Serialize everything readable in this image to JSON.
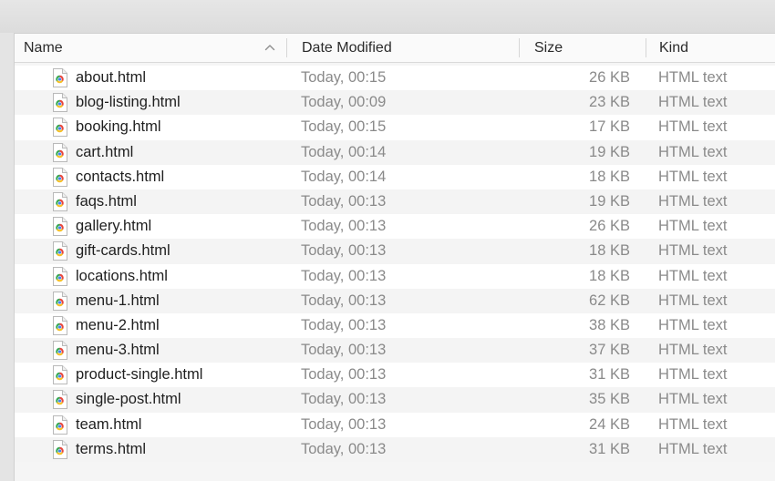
{
  "header": {
    "name": "Name",
    "date_modified": "Date Modified",
    "size": "Size",
    "kind": "Kind"
  },
  "sort": {
    "column": "Name",
    "direction": "ascending",
    "icon": "chevron-up-icon"
  },
  "colors": {
    "icon_red": "#e8453c",
    "icon_yellow": "#f6c026",
    "icon_green": "#34a853",
    "icon_blue": "#4285f4"
  },
  "files": [
    {
      "name": "about.html",
      "date": "Today, 00:15",
      "size": "26 KB",
      "kind": "HTML text"
    },
    {
      "name": "blog-listing.html",
      "date": "Today, 00:09",
      "size": "23 KB",
      "kind": "HTML text"
    },
    {
      "name": "booking.html",
      "date": "Today, 00:15",
      "size": "17 KB",
      "kind": "HTML text"
    },
    {
      "name": "cart.html",
      "date": "Today, 00:14",
      "size": "19 KB",
      "kind": "HTML text"
    },
    {
      "name": "contacts.html",
      "date": "Today, 00:14",
      "size": "18 KB",
      "kind": "HTML text"
    },
    {
      "name": "faqs.html",
      "date": "Today, 00:13",
      "size": "19 KB",
      "kind": "HTML text"
    },
    {
      "name": "gallery.html",
      "date": "Today, 00:13",
      "size": "26 KB",
      "kind": "HTML text"
    },
    {
      "name": "gift-cards.html",
      "date": "Today, 00:13",
      "size": "18 KB",
      "kind": "HTML text"
    },
    {
      "name": "locations.html",
      "date": "Today, 00:13",
      "size": "18 KB",
      "kind": "HTML text"
    },
    {
      "name": "menu-1.html",
      "date": "Today, 00:13",
      "size": "62 KB",
      "kind": "HTML text"
    },
    {
      "name": "menu-2.html",
      "date": "Today, 00:13",
      "size": "38 KB",
      "kind": "HTML text"
    },
    {
      "name": "menu-3.html",
      "date": "Today, 00:13",
      "size": "37 KB",
      "kind": "HTML text"
    },
    {
      "name": "product-single.html",
      "date": "Today, 00:13",
      "size": "31 KB",
      "kind": "HTML text"
    },
    {
      "name": "single-post.html",
      "date": "Today, 00:13",
      "size": "35 KB",
      "kind": "HTML text"
    },
    {
      "name": "team.html",
      "date": "Today, 00:13",
      "size": "24 KB",
      "kind": "HTML text"
    },
    {
      "name": "terms.html",
      "date": "Today, 00:13",
      "size": "31 KB",
      "kind": "HTML text"
    }
  ]
}
